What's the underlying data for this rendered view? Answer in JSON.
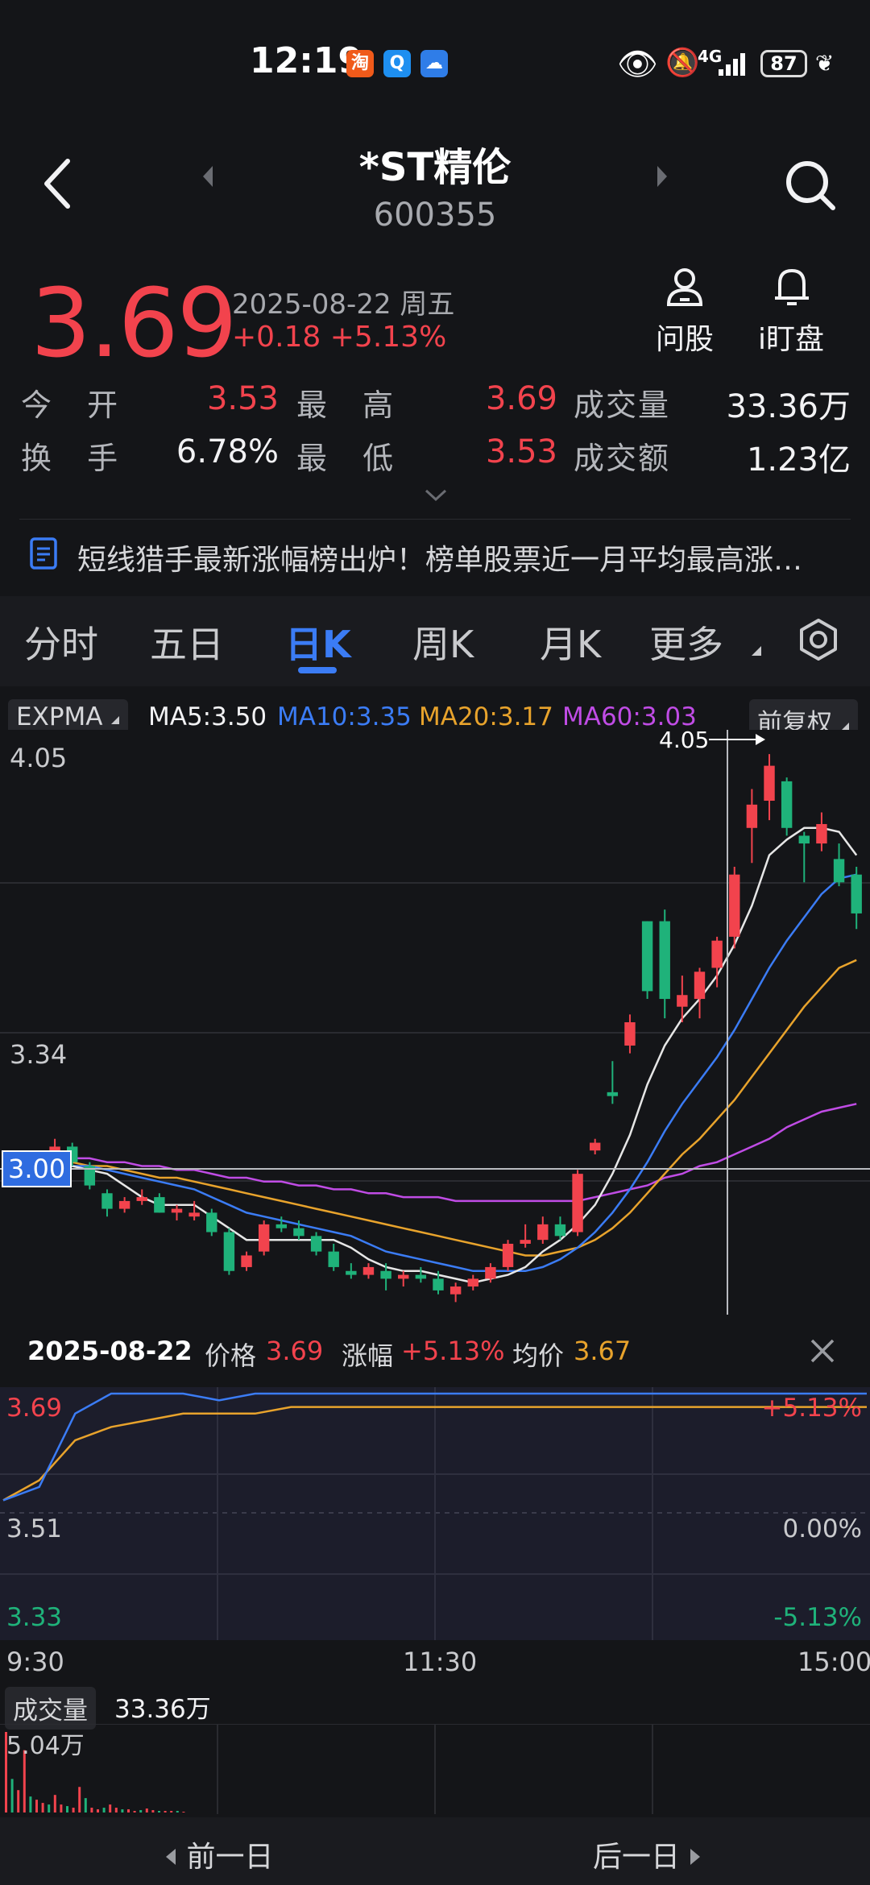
{
  "status_bar": {
    "time": "12:19",
    "network": "4G",
    "battery": "87"
  },
  "header": {
    "title": "*ST精伦",
    "code": "600355"
  },
  "quote": {
    "price": "3.69",
    "date": "2025-08-22 周五",
    "change": "+0.18 +5.13%",
    "ask_label": "问股",
    "watch_label": "i盯盘",
    "open_label": "今 开",
    "open": "3.53",
    "high_label": "最 高",
    "high": "3.69",
    "volume_label": "成交量",
    "volume": "33.36万",
    "turnover_label": "换 手",
    "turnover": "6.78%",
    "low_label": "最 低",
    "low": "3.53",
    "amount_label": "成交额",
    "amount": "1.23亿"
  },
  "news": {
    "text": "短线猎手最新涨幅榜出炉！榜单股票近一月平均最高涨…"
  },
  "tabs": [
    "分时",
    "五日",
    "日K",
    "周K",
    "月K",
    "更多"
  ],
  "indicator_bar": {
    "indicator": "EXPMA",
    "ma5": "MA5:3.50",
    "ma10": "MA10:3.35",
    "ma20": "MA20:3.17",
    "ma60": "MA60:3.03",
    "adjust": "前复权"
  },
  "kline": {
    "y_top": "4.05",
    "y_mid": "3.34",
    "crosshair_price": "3.00",
    "peak_label": "4.05",
    "colors": {
      "up": "#f2434d",
      "down": "#1fb27a",
      "ma5": "#e6e6e6",
      "ma10": "#3b7cf5",
      "ma20": "#e8a32c",
      "ma60": "#c04ce5"
    }
  },
  "chart_data": [
    {
      "type": "candlestick",
      "ylim": [
        2.62,
        4.1
      ],
      "candles": [
        [
          3.0,
          3.02,
          2.96,
          2.97
        ],
        [
          2.97,
          3.0,
          2.95,
          2.98
        ],
        [
          2.98,
          3.06,
          2.97,
          3.04
        ],
        [
          3.04,
          3.05,
          2.99,
          3.0
        ],
        [
          2.99,
          3.0,
          2.93,
          2.94
        ],
        [
          2.92,
          2.93,
          2.86,
          2.88
        ],
        [
          2.88,
          2.91,
          2.87,
          2.9
        ],
        [
          2.9,
          2.93,
          2.89,
          2.91
        ],
        [
          2.91,
          2.92,
          2.87,
          2.87
        ],
        [
          2.87,
          2.89,
          2.85,
          2.88
        ],
        [
          2.86,
          2.9,
          2.85,
          2.87
        ],
        [
          2.87,
          2.88,
          2.81,
          2.82
        ],
        [
          2.82,
          2.83,
          2.71,
          2.72
        ],
        [
          2.73,
          2.77,
          2.72,
          2.76
        ],
        [
          2.77,
          2.85,
          2.76,
          2.84
        ],
        [
          2.84,
          2.86,
          2.82,
          2.83
        ],
        [
          2.83,
          2.85,
          2.8,
          2.81
        ],
        [
          2.81,
          2.82,
          2.76,
          2.77
        ],
        [
          2.77,
          2.79,
          2.72,
          2.73
        ],
        [
          2.72,
          2.74,
          2.7,
          2.71
        ],
        [
          2.71,
          2.74,
          2.7,
          2.73
        ],
        [
          2.72,
          2.74,
          2.67,
          2.7
        ],
        [
          2.7,
          2.72,
          2.68,
          2.71
        ],
        [
          2.71,
          2.73,
          2.69,
          2.7
        ],
        [
          2.7,
          2.72,
          2.66,
          2.67
        ],
        [
          2.66,
          2.69,
          2.64,
          2.68
        ],
        [
          2.68,
          2.71,
          2.67,
          2.7
        ],
        [
          2.7,
          2.74,
          2.69,
          2.73
        ],
        [
          2.73,
          2.8,
          2.72,
          2.79
        ],
        [
          2.79,
          2.84,
          2.78,
          2.8
        ],
        [
          2.8,
          2.86,
          2.79,
          2.84
        ],
        [
          2.84,
          2.86,
          2.8,
          2.81
        ],
        [
          2.82,
          2.98,
          2.81,
          2.97
        ],
        [
          3.03,
          3.06,
          3.02,
          3.05
        ],
        [
          3.18,
          3.26,
          3.15,
          3.17
        ],
        [
          3.3,
          3.38,
          3.28,
          3.36
        ],
        [
          3.62,
          3.62,
          3.42,
          3.44
        ],
        [
          3.62,
          3.65,
          3.37,
          3.42
        ],
        [
          3.4,
          3.48,
          3.36,
          3.43
        ],
        [
          3.42,
          3.5,
          3.37,
          3.49
        ],
        [
          3.5,
          3.58,
          3.45,
          3.57
        ],
        [
          3.58,
          3.76,
          3.55,
          3.74
        ],
        [
          3.86,
          3.96,
          3.77,
          3.92
        ],
        [
          3.93,
          4.05,
          3.88,
          4.02
        ],
        [
          3.98,
          3.99,
          3.84,
          3.86
        ],
        [
          3.84,
          3.85,
          3.72,
          3.82
        ],
        [
          3.82,
          3.9,
          3.8,
          3.87
        ],
        [
          3.78,
          3.82,
          3.71,
          3.72
        ],
        [
          3.74,
          3.76,
          3.6,
          3.64
        ]
      ],
      "ma5": [
        2.98,
        2.97,
        2.98,
        2.99,
        2.98,
        2.97,
        2.94,
        2.91,
        2.89,
        2.89,
        2.89,
        2.86,
        2.83,
        2.8,
        2.8,
        2.8,
        2.8,
        2.8,
        2.8,
        2.78,
        2.75,
        2.73,
        2.72,
        2.72,
        2.71,
        2.7,
        2.69,
        2.7,
        2.71,
        2.73,
        2.77,
        2.8,
        2.84,
        2.89,
        2.97,
        3.07,
        3.2,
        3.3,
        3.37,
        3.42,
        3.48,
        3.56,
        3.66,
        3.79,
        3.83,
        3.86,
        3.86,
        3.85,
        3.79
      ],
      "ma10": [
        2.99,
        2.99,
        2.99,
        2.99,
        2.99,
        2.98,
        2.97,
        2.96,
        2.95,
        2.94,
        2.93,
        2.91,
        2.89,
        2.87,
        2.86,
        2.85,
        2.84,
        2.83,
        2.82,
        2.81,
        2.79,
        2.77,
        2.76,
        2.75,
        2.74,
        2.73,
        2.72,
        2.72,
        2.72,
        2.72,
        2.73,
        2.75,
        2.78,
        2.82,
        2.87,
        2.93,
        3.0,
        3.08,
        3.15,
        3.21,
        3.27,
        3.34,
        3.42,
        3.5,
        3.57,
        3.63,
        3.69,
        3.73,
        3.74
      ],
      "ma20": [
        3.0,
        3.0,
        3.0,
        3.0,
        2.99,
        2.99,
        2.98,
        2.97,
        2.96,
        2.96,
        2.95,
        2.94,
        2.93,
        2.92,
        2.91,
        2.9,
        2.89,
        2.88,
        2.87,
        2.86,
        2.85,
        2.84,
        2.83,
        2.82,
        2.81,
        2.8,
        2.79,
        2.78,
        2.77,
        2.76,
        2.76,
        2.77,
        2.78,
        2.8,
        2.83,
        2.87,
        2.92,
        2.97,
        3.02,
        3.06,
        3.11,
        3.16,
        3.22,
        3.28,
        3.34,
        3.4,
        3.45,
        3.5,
        3.52
      ],
      "ma60": [
        3.02,
        3.02,
        3.02,
        3.01,
        3.01,
        3.0,
        3.0,
        2.99,
        2.99,
        2.98,
        2.98,
        2.97,
        2.96,
        2.96,
        2.95,
        2.95,
        2.94,
        2.94,
        2.93,
        2.93,
        2.92,
        2.92,
        2.91,
        2.91,
        2.91,
        2.9,
        2.9,
        2.9,
        2.9,
        2.9,
        2.9,
        2.9,
        2.9,
        2.91,
        2.92,
        2.93,
        2.94,
        2.96,
        2.97,
        2.99,
        3.0,
        3.02,
        3.04,
        3.06,
        3.09,
        3.11,
        3.13,
        3.14,
        3.15
      ]
    },
    {
      "type": "line",
      "date": "2025-08-22",
      "price_label": "价格",
      "price": "3.69",
      "change_label": "涨幅",
      "change": "+5.13%",
      "avg_label": "均价",
      "avg": "3.67",
      "y_labels": {
        "top": "3.69",
        "mid": "3.51",
        "bottom": "3.33",
        "pct_top": "+5.13%",
        "pct_mid": "0.00%",
        "pct_bottom": "-5.13%"
      },
      "x_labels": [
        "9:30",
        "11:30",
        "15:00"
      ],
      "ylim": [
        3.33,
        3.69
      ],
      "price_series": [
        3.53,
        3.55,
        3.66,
        3.69,
        3.69,
        3.69,
        3.68,
        3.69,
        3.69,
        3.69,
        3.69,
        3.69,
        3.69,
        3.69,
        3.69,
        3.69,
        3.69,
        3.69,
        3.69,
        3.69,
        3.69,
        3.69,
        3.69,
        3.69,
        3.69
      ],
      "avg_series": [
        3.53,
        3.56,
        3.62,
        3.64,
        3.65,
        3.66,
        3.66,
        3.66,
        3.67,
        3.67,
        3.67,
        3.67,
        3.67,
        3.67,
        3.67,
        3.67,
        3.67,
        3.67,
        3.67,
        3.67,
        3.67,
        3.67,
        3.67,
        3.67,
        3.67
      ],
      "volume_label": "成交量",
      "volume": "33.36万",
      "volume_max": "5.04万",
      "volume_bars": [
        5.04,
        2.1,
        1.4,
        3.9,
        1.0,
        0.8,
        0.6,
        0.5,
        1.1,
        0.5,
        0.4,
        0.3,
        1.6,
        0.9,
        0.3,
        0.2,
        0.3,
        0.5,
        0.3,
        0.2,
        0.2,
        0.1,
        0.15,
        0.25,
        0.15,
        0.1,
        0.1,
        0.1,
        0.1,
        0.05
      ]
    }
  ],
  "bottom_nav": {
    "prev": "前一日",
    "next": "后一日"
  }
}
